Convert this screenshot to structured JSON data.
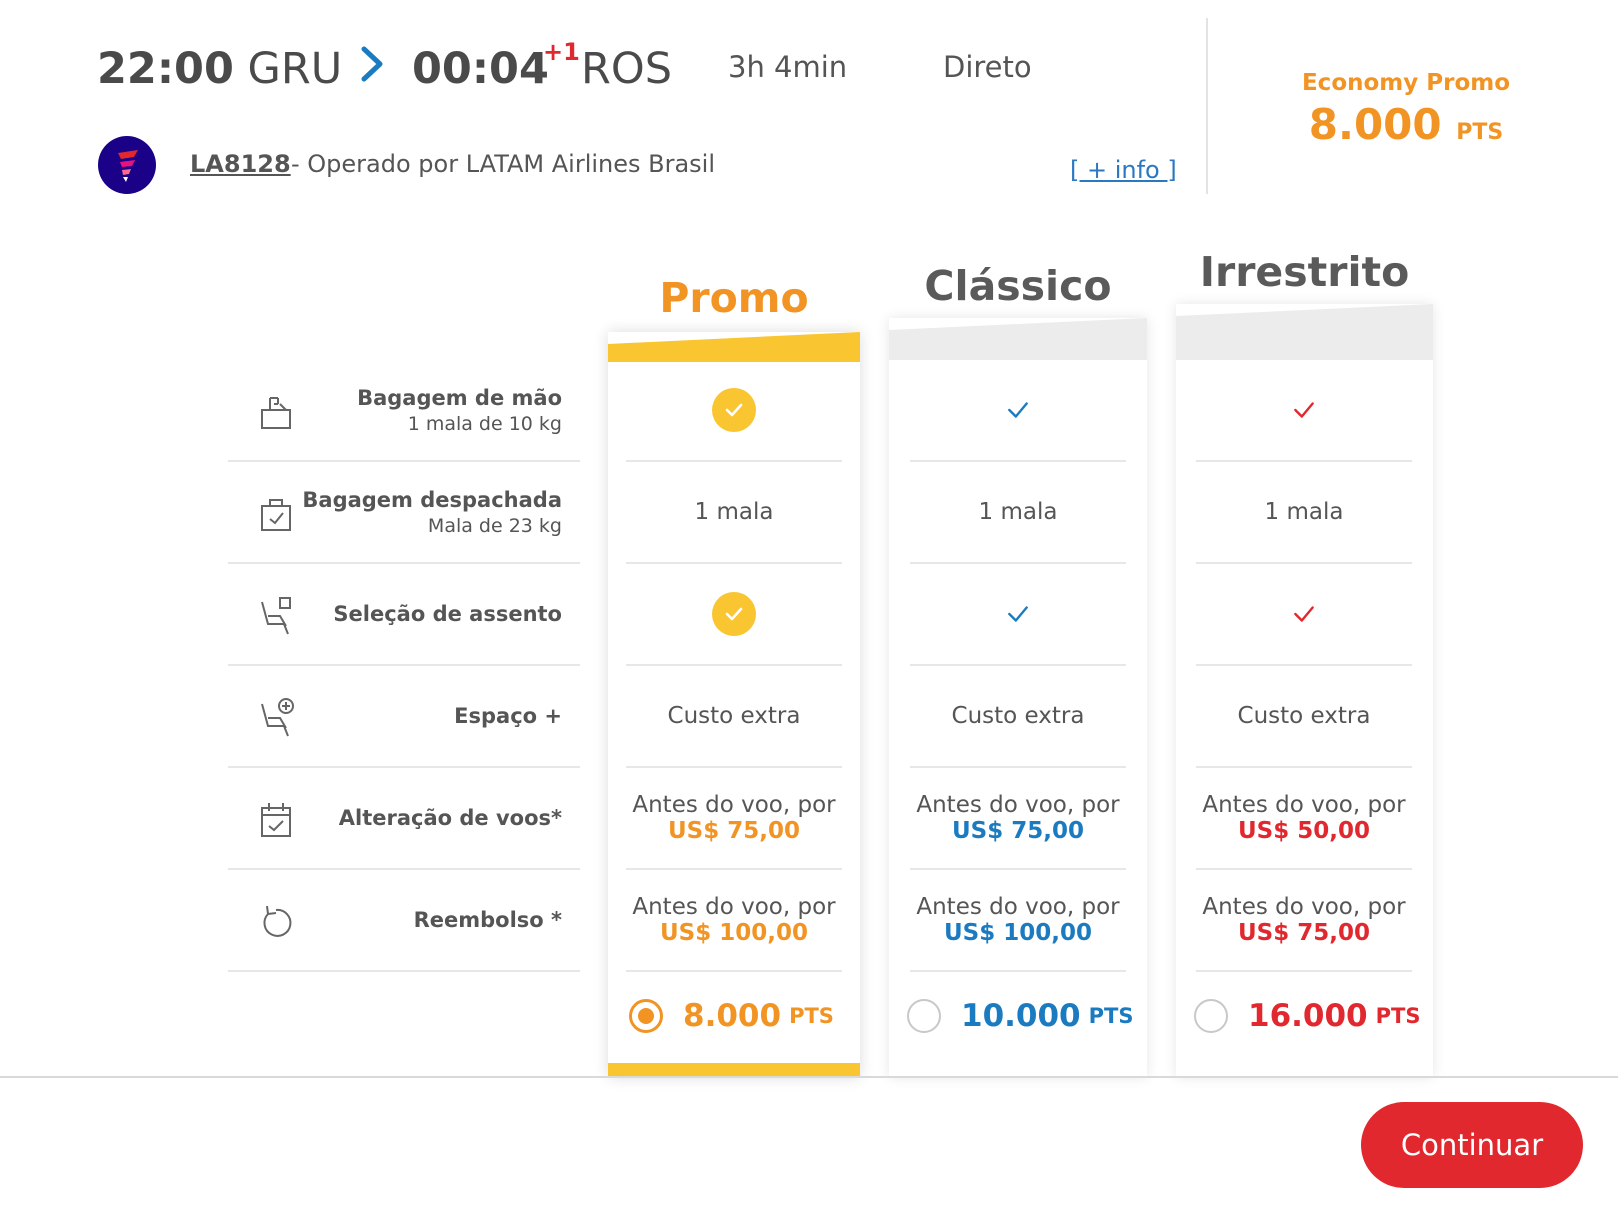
{
  "flight": {
    "departure_time": "22:00",
    "departure_airport": "GRU",
    "arrival_time": "00:04",
    "arrival_day_offset": "+1",
    "arrival_airport": "ROS",
    "duration": "3h 4min",
    "stops": "Direto",
    "flight_number": "LA8128",
    "operated_by": "- Operado por LATAM Airlines Brasil",
    "more_info": "[ + info ]"
  },
  "selected_fare": {
    "cabin": "Economy Promo",
    "price": "8.000",
    "unit": "PTS"
  },
  "fares": [
    {
      "name": "Promo",
      "color": "#f29423",
      "price": "8.000",
      "unit": "PTS",
      "selected": true
    },
    {
      "name": "Clássico",
      "color": "#1b7bc0",
      "price": "10.000",
      "unit": "PTS",
      "selected": false
    },
    {
      "name": "Irrestrito",
      "color": "#e1282e",
      "price": "16.000",
      "unit": "PTS",
      "selected": false
    }
  ],
  "features": [
    {
      "title": "Bagagem de mão",
      "sub": "1 mala de 10 kg",
      "icon": "carry-on-bag-icon"
    },
    {
      "title": "Bagagem despachada",
      "sub": "Mala de 23 kg",
      "icon": "checked-bag-icon"
    },
    {
      "title": "Seleção de assento",
      "sub": "",
      "icon": "seat-icon"
    },
    {
      "title": "Espaço +",
      "sub": "",
      "icon": "seat-plus-icon"
    },
    {
      "title": "Alteração de voos*",
      "sub": "",
      "icon": "calendar-change-icon"
    },
    {
      "title": "Reembolso *",
      "sub": "",
      "icon": "refund-icon"
    }
  ],
  "cells": {
    "checked_bag": [
      "1 mala",
      "1 mala",
      "1 mala"
    ],
    "extra_space": [
      "Custo extra",
      "Custo extra",
      "Custo extra"
    ],
    "change": {
      "prefix": [
        "Antes do voo, por",
        "Antes do voo, por",
        "Antes do voo, por"
      ],
      "price": [
        "US$ 75,00",
        "US$ 75,00",
        "US$ 50,00"
      ]
    },
    "refund": {
      "prefix": [
        "Antes do voo, por",
        "Antes do voo, por",
        "Antes do voo, por"
      ],
      "price": [
        "US$ 100,00",
        "US$ 100,00",
        "US$ 75,00"
      ]
    }
  },
  "actions": {
    "continue": "Continuar"
  }
}
